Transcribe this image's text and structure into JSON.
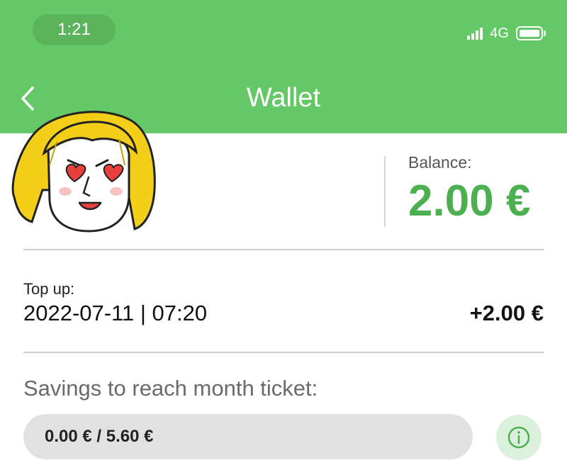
{
  "status_bar": {
    "time": "1:21",
    "network": "4G",
    "signal_bars": 4,
    "battery_level": 0.9
  },
  "header": {
    "title": "Wallet",
    "background_color": "#65c866"
  },
  "balance": {
    "label": "Balance:",
    "value": "2.00 €",
    "color": "#4caf50"
  },
  "topup": {
    "label": "Top up:",
    "datetime": "2022-07-11 | 07:20",
    "amount": "+2.00 €"
  },
  "savings": {
    "label": "Savings to reach month ticket:",
    "progress_text": "0.00 € / 5.60 €",
    "progress_fraction": 0.0
  },
  "icons": {
    "back": "chevron-left-icon",
    "info": "info-circle-icon",
    "avatar": "heart-eyes-girl-sticker"
  }
}
